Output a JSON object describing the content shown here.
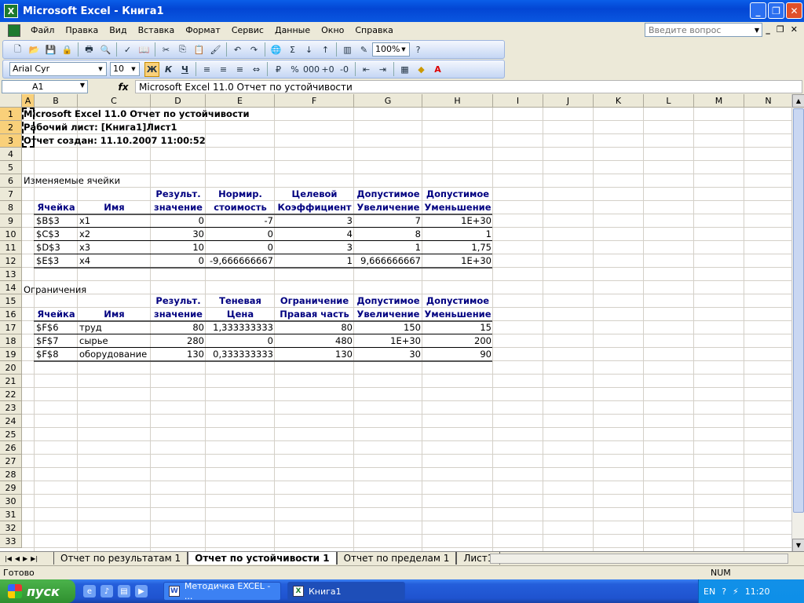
{
  "window": {
    "title": "Microsoft Excel - Книга1",
    "app_letter": "X"
  },
  "menu": [
    "Файл",
    "Правка",
    "Вид",
    "Вставка",
    "Формат",
    "Сервис",
    "Данные",
    "Окно",
    "Справка"
  ],
  "help_placeholder": "Введите вопрос",
  "toolbar": {
    "zoom": "100%",
    "font": "Arial Cyr",
    "size": "10",
    "bold": "Ж",
    "italic": "К",
    "underline": "Ч"
  },
  "formula_bar": {
    "cell_ref": "A1",
    "fx": "fx",
    "content": "Microsoft Excel 11.0 Отчет по устойчивости"
  },
  "columns": [
    "A",
    "B",
    "C",
    "D",
    "E",
    "F",
    "G",
    "H",
    "I",
    "J",
    "K",
    "L",
    "M",
    "N"
  ],
  "rows": [
    "1",
    "2",
    "3",
    "4",
    "5",
    "6",
    "7",
    "8",
    "9",
    "10",
    "11",
    "12",
    "13",
    "14",
    "15",
    "16",
    "17",
    "18",
    "19",
    "20",
    "21",
    "22",
    "23",
    "24",
    "25",
    "26",
    "27",
    "28",
    "29",
    "30",
    "31",
    "32",
    "33"
  ],
  "report": {
    "line1": "Microsoft Excel 11.0 Отчет по устойчивости",
    "line2": "Рабочий лист: [Книга1]Лист1",
    "line3": "Отчет создан: 11.10.2007 11:00:52"
  },
  "section1": {
    "title": "Изменяемые ячейки",
    "hdr_top": [
      "",
      "",
      "Результ.",
      "Нормир.",
      "Целевой",
      "Допустимое",
      "Допустимое"
    ],
    "hdr_bot": [
      "Ячейка",
      "Имя",
      "значение",
      "стоимость",
      "Коэффициент",
      "Увеличение",
      "Уменьшение"
    ],
    "rows": [
      [
        "$B$3",
        "x1",
        "0",
        "-7",
        "3",
        "7",
        "1E+30"
      ],
      [
        "$C$3",
        "x2",
        "30",
        "0",
        "4",
        "8",
        "1"
      ],
      [
        "$D$3",
        "x3",
        "10",
        "0",
        "3",
        "1",
        "1,75"
      ],
      [
        "$E$3",
        "x4",
        "0",
        "-9,666666667",
        "1",
        "9,666666667",
        "1E+30"
      ]
    ]
  },
  "section2": {
    "title": "Ограничения",
    "hdr_top": [
      "",
      "",
      "Результ.",
      "Теневая",
      "Ограничение",
      "Допустимое",
      "Допустимое"
    ],
    "hdr_bot": [
      "Ячейка",
      "Имя",
      "значение",
      "Цена",
      "Правая часть",
      "Увеличение",
      "Уменьшение"
    ],
    "rows": [
      [
        "$F$6",
        "труд",
        "80",
        "1,333333333",
        "80",
        "150",
        "15"
      ],
      [
        "$F$7",
        "сырье",
        "280",
        "0",
        "480",
        "1E+30",
        "200"
      ],
      [
        "$F$8",
        "оборудование",
        "130",
        "0,333333333",
        "130",
        "30",
        "90"
      ]
    ]
  },
  "sheets": [
    "Отчет по результатам 1",
    "Отчет по устойчивости 1",
    "Отчет по пределам 1",
    "Лист1"
  ],
  "status": {
    "ready": "Готово",
    "num": "NUM"
  },
  "taskbar": {
    "start": "пуск",
    "tasks": [
      "Методичка EXCEL - ...",
      "Книга1"
    ],
    "lang": "EN",
    "clock": "11:20"
  }
}
